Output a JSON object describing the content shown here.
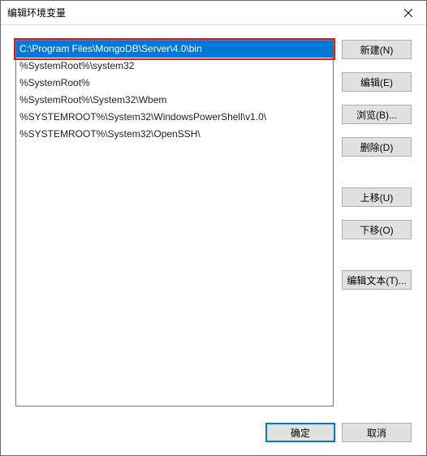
{
  "title": "编辑环境变量",
  "list": {
    "items": [
      "C:\\Program Files\\MongoDB\\Server\\4.0\\bin",
      "%SystemRoot%\\system32",
      "%SystemRoot%",
      "%SystemRoot%\\System32\\Wbem",
      "%SYSTEMROOT%\\System32\\WindowsPowerShell\\v1.0\\",
      "%SYSTEMROOT%\\System32\\OpenSSH\\"
    ],
    "selected_index": 0
  },
  "buttons": {
    "new": "新建(N)",
    "edit": "编辑(E)",
    "browse": "浏览(B)...",
    "delete": "删除(D)",
    "move_up": "上移(U)",
    "move_down": "下移(O)",
    "edit_text": "编辑文本(T)..."
  },
  "footer": {
    "ok": "确定",
    "cancel": "取消"
  },
  "annotation": {
    "highlight_row": 0,
    "color": "#e11515"
  }
}
